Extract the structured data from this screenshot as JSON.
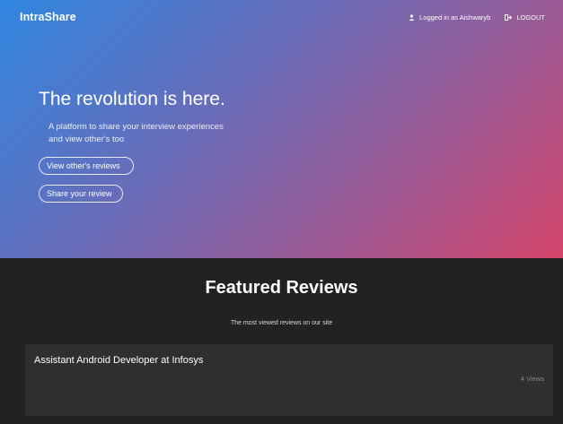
{
  "navbar": {
    "brand": "IntraShare",
    "user_icon": "user-icon",
    "logged_in_text": "Logged in as Aishwaryb",
    "logout_icon": "logout-icon",
    "logout_label": "LOGOUT"
  },
  "hero": {
    "headline": "The revolution is here.",
    "subtext": "A platform to share your interview experiences and view other's too",
    "view_reviews_label": "View other's reviews",
    "share_review_label": "Share your review",
    "gradient_colors": [
      "#2f86e0",
      "#6a6cb8",
      "#9d5a94",
      "#d4456a"
    ]
  },
  "featured": {
    "title": "Featured Reviews",
    "subtitle": "The most viewed reviews on our site",
    "background": "#222222",
    "reviews": [
      {
        "title": "Assistant Android Developer at Infosys",
        "views": "4 Views"
      }
    ]
  }
}
